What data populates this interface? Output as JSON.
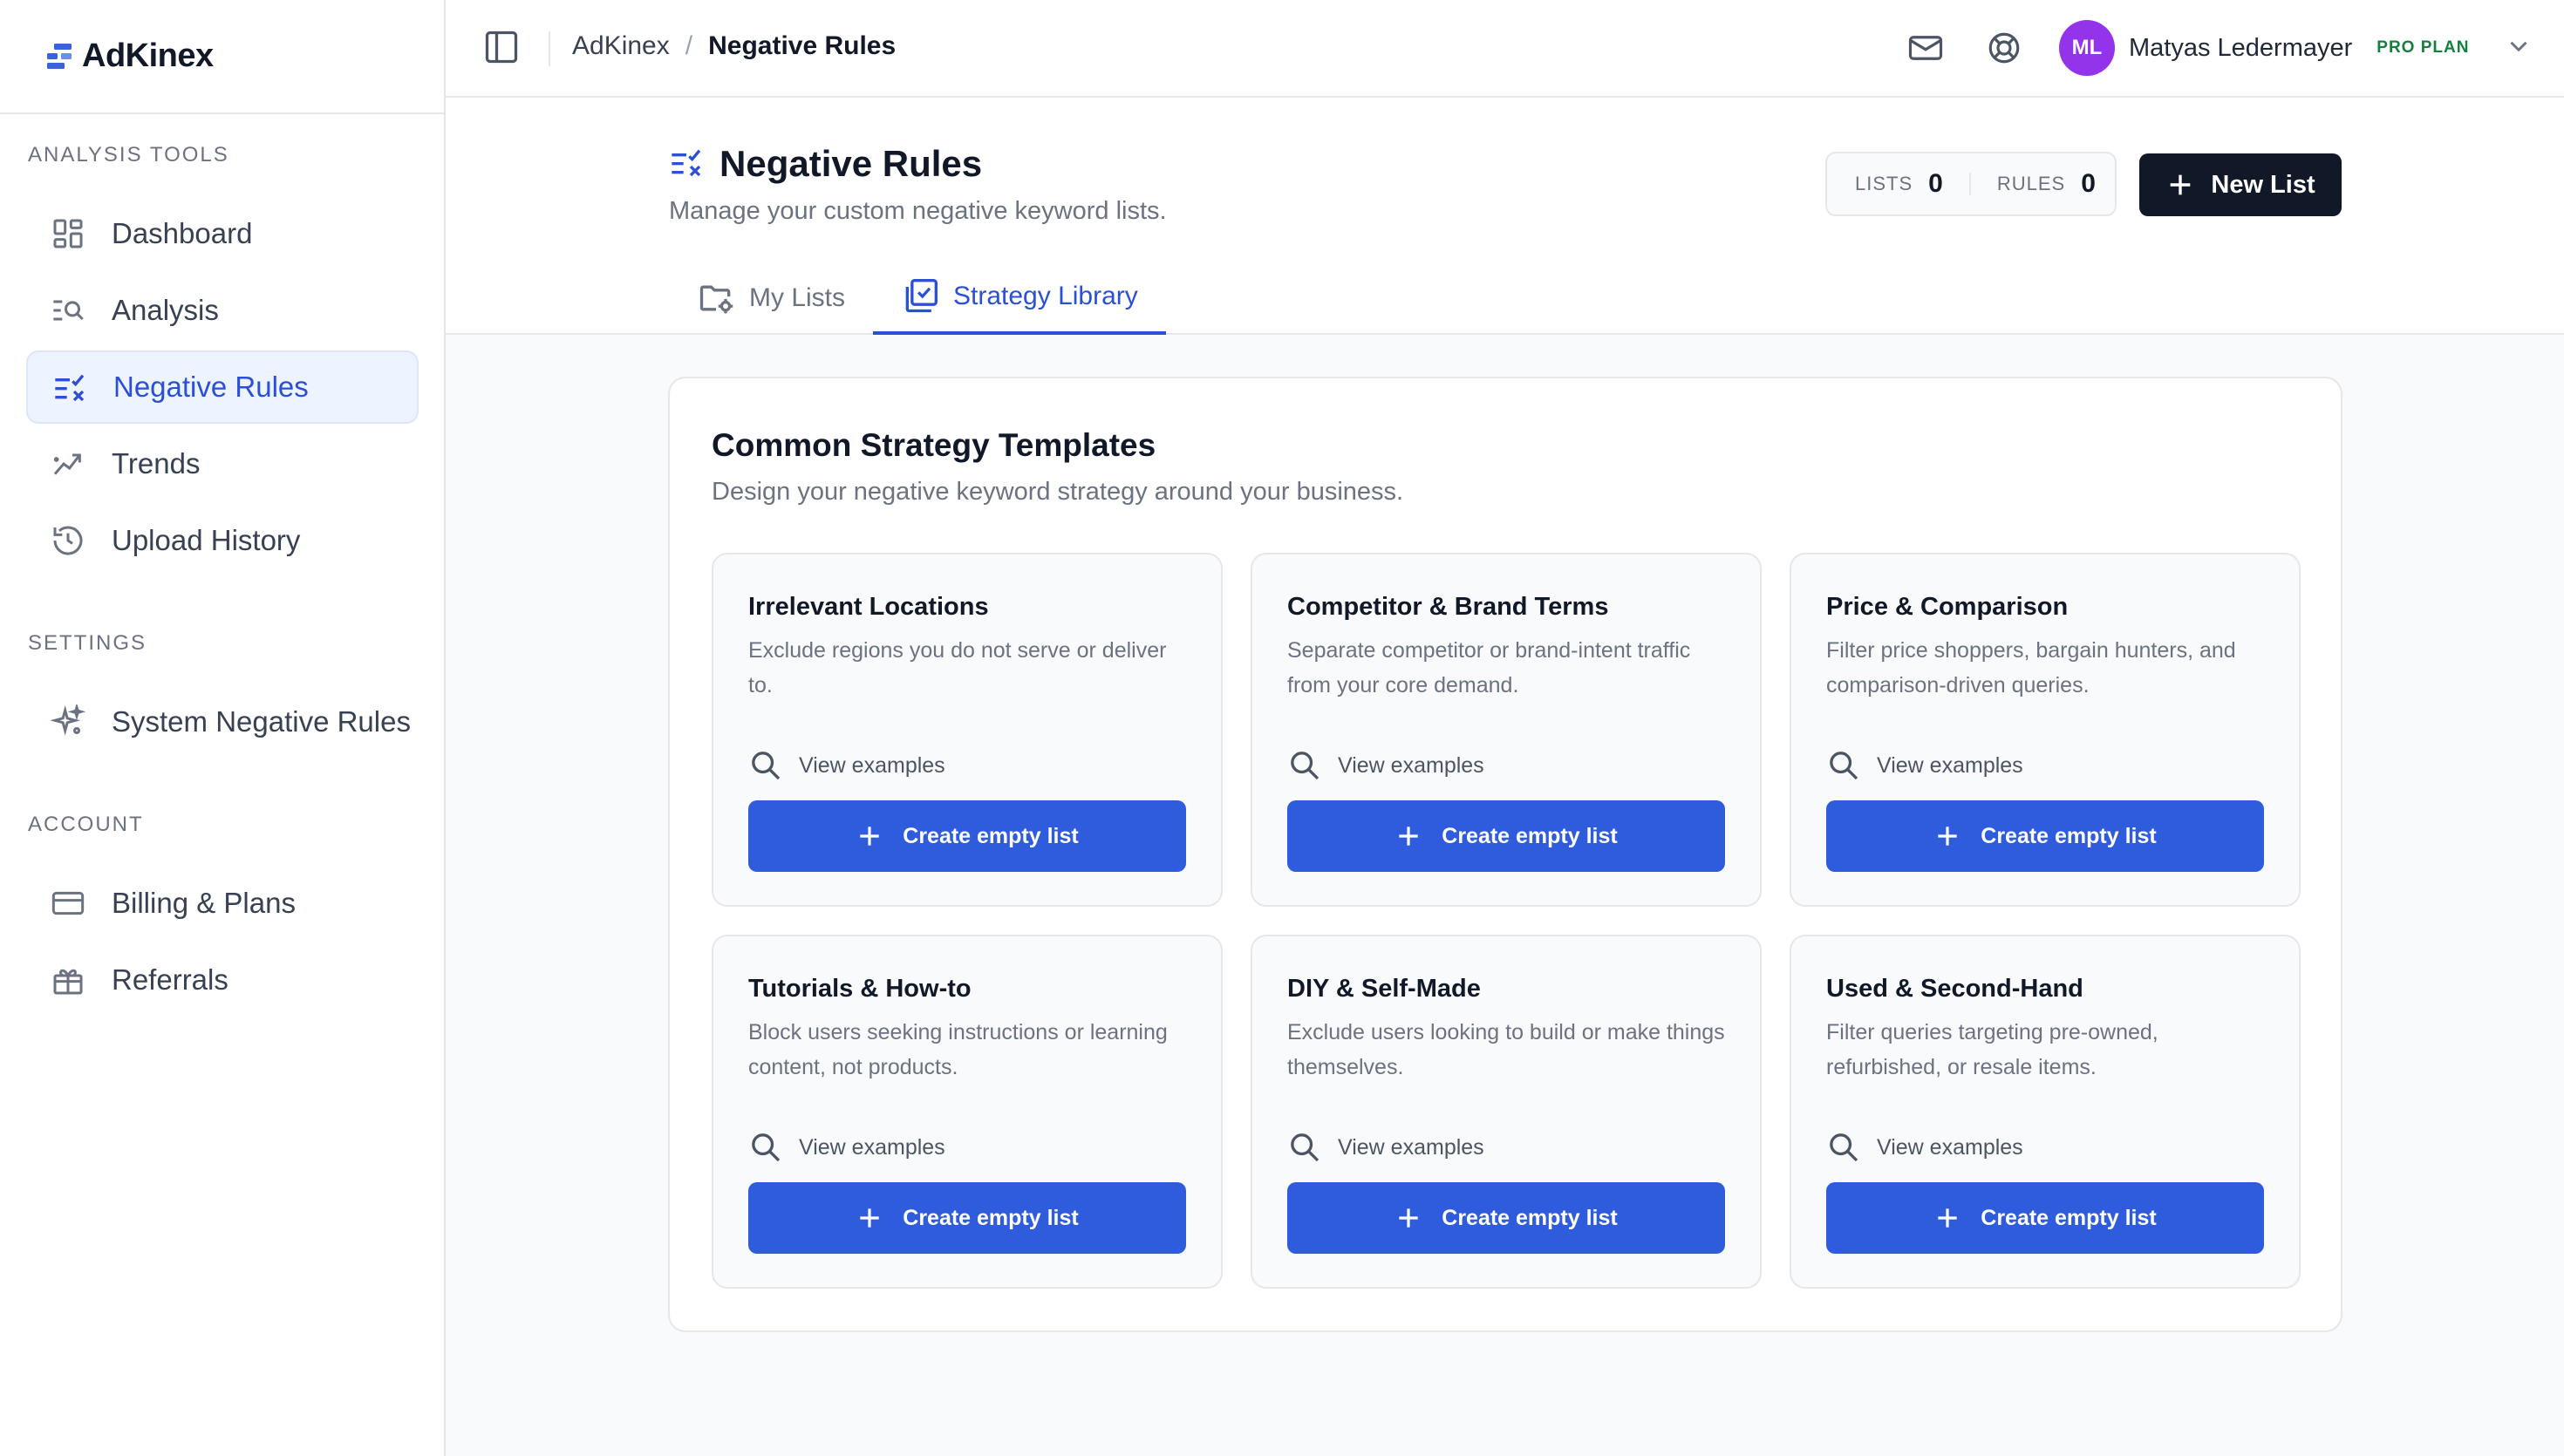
{
  "app": {
    "name": "AdKinex"
  },
  "sidebar": {
    "sections": [
      {
        "title": "ANALYSIS TOOLS"
      },
      {
        "title": "SETTINGS"
      },
      {
        "title": "ACCOUNT"
      }
    ],
    "items": [
      {
        "label": "Dashboard",
        "icon": "dashboard-icon"
      },
      {
        "label": "Analysis",
        "icon": "analysis-icon"
      },
      {
        "label": "Negative Rules",
        "icon": "negative-rules-icon",
        "active": true
      },
      {
        "label": "Trends",
        "icon": "trends-icon"
      },
      {
        "label": "Upload History",
        "icon": "history-icon"
      },
      {
        "label": "System Negative Rules",
        "icon": "sparkles-icon"
      },
      {
        "label": "Billing & Plans",
        "icon": "credit-card-icon"
      },
      {
        "label": "Referrals",
        "icon": "gift-icon"
      }
    ]
  },
  "topbar": {
    "breadcrumb": {
      "root": "AdKinex",
      "current": "Negative Rules"
    },
    "user": {
      "initials": "ML",
      "name": "Matyas Ledermayer",
      "plan": "PRO PLAN"
    }
  },
  "header": {
    "title": "Negative Rules",
    "subtitle": "Manage your custom negative keyword lists.",
    "stats": {
      "lists_label": "LISTS",
      "lists_value": "0",
      "rules_label": "RULES",
      "rules_value": "0"
    },
    "new_list_label": "New List",
    "tabs": [
      {
        "label": "My Lists"
      },
      {
        "label": "Strategy Library",
        "active": true
      }
    ]
  },
  "library": {
    "title": "Common Strategy Templates",
    "subtitle": "Design your negative keyword strategy around your business.",
    "view_label": "View examples",
    "create_label": "Create empty list",
    "templates": [
      {
        "title": "Irrelevant Locations",
        "desc": "Exclude regions you do not serve or deliver to."
      },
      {
        "title": "Competitor & Brand Terms",
        "desc": "Separate competitor or brand-intent traffic from your core demand."
      },
      {
        "title": "Price & Comparison",
        "desc": "Filter price shoppers, bargain hunters, and comparison-driven queries."
      },
      {
        "title": "Tutorials & How-to",
        "desc": "Block users seeking instructions or learning content, not products."
      },
      {
        "title": "DIY & Self-Made",
        "desc": "Exclude users looking to build or make things themselves."
      },
      {
        "title": "Used & Second-Hand",
        "desc": "Filter queries targeting pre-owned, refurbished, or resale items."
      }
    ]
  },
  "colors": {
    "accent": "#2f5bdd",
    "dark": "#111827",
    "avatar": "#9333ea",
    "plan": "#15803d"
  }
}
